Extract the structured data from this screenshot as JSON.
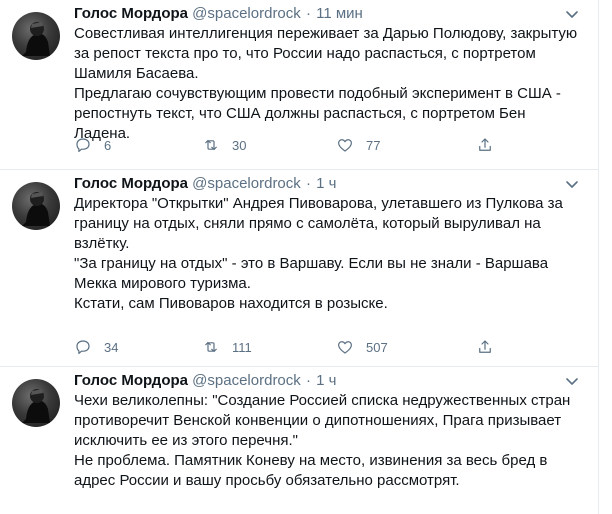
{
  "tweets": [
    {
      "name": "Голос Мордора",
      "handle": "@spacelordrock",
      "time": "11 мин",
      "lines": [
        "Совестливая интеллигенция переживает за Дарью Полюдову, закрытую за репост текста про то, что России надо распасться, с портретом Шамиля Басаева.",
        "Предлагаю сочувствующим провести подобный эксперимент в США - репостнуть текст, что США должны распасться, с портретом Бен Ладена."
      ],
      "replies": "6",
      "retweets": "30",
      "likes": "77"
    },
    {
      "name": "Голос Мордора",
      "handle": "@spacelordrock",
      "time": "1 ч",
      "lines": [
        "Директора \"Открытки\" Андрея Пивоварова, улетавшего из Пулкова за границу на отдых, сняли прямо с самолёта, который выруливал на взлётку.",
        "\"За границу на отдых\" - это в Варшаву. Если вы не знали - Варшава Мекка мирового туризма.",
        "Кстати, сам Пивоваров находится в розыске."
      ],
      "replies": "34",
      "retweets": "111",
      "likes": "507"
    },
    {
      "name": "Голос Мордора",
      "handle": "@spacelordrock",
      "time": "1 ч",
      "lines": [
        "Чехи великолепны: \"Создание Россией списка недружественных стран противоречит Венской конвенции о дипотношениях, Прага призывает исключить ее из этого перечня.\"",
        "Не проблема. Памятник Коневу на место, извинения за весь бред в адрес России и вашу просьбу обязательно рассмотрят."
      ]
    }
  ],
  "icons": {
    "reply": "reply-icon",
    "retweet": "retweet-icon",
    "like": "like-icon",
    "share": "share-icon",
    "more": "chevron-down-icon"
  },
  "colors": {
    "text": "#0f1419",
    "secondary": "#5b7083",
    "divider": "#e6ecf0"
  }
}
